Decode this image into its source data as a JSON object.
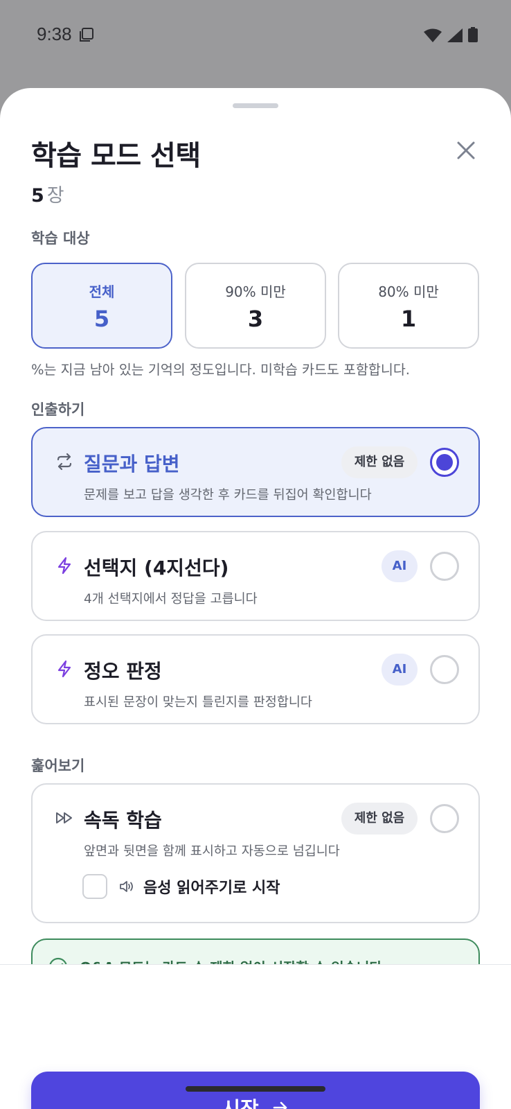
{
  "status_bar": {
    "time": "9:38",
    "left_icon": "screenshot-notification-icon",
    "right_icons": [
      "wifi-icon",
      "cell-signal-icon",
      "battery-icon"
    ]
  },
  "sheet": {
    "title": "학습 모드 선택",
    "close_icon": "close-icon",
    "count_value": "5",
    "count_unit": "장"
  },
  "target_section": {
    "label": "학습 대상",
    "options": [
      {
        "label": "전체",
        "value": "5",
        "selected": true
      },
      {
        "label": "90% 미만",
        "value": "3",
        "selected": false
      },
      {
        "label": "80% 미만",
        "value": "1",
        "selected": false
      }
    ],
    "hint": "%는 지금 남아 있는 기억의 정도입니다. 미학습 카드도 포함합니다."
  },
  "recall_section": {
    "label": "인출하기",
    "modes": [
      {
        "icon": "repeat-icon",
        "title": "질문과 답변",
        "description": "문제를 보고 답을 생각한 후 카드를 뒤집어 확인합니다",
        "badge": "제한 없음",
        "selected": true
      },
      {
        "icon": "lightning-icon",
        "title": "선택지 (4지선다)",
        "description": "4개 선택지에서 정답을 고릅니다",
        "badge": "AI",
        "selected": false
      },
      {
        "icon": "lightning-icon",
        "title": "정오 판정",
        "description": "표시된 문장이 맞는지 틀린지를 판정합니다",
        "badge": "AI",
        "selected": false
      }
    ]
  },
  "skim_section": {
    "label": "훑어보기",
    "mode": {
      "icon": "fast-forward-icon",
      "title": "속독 학습",
      "description": "앞면과 뒷면을 함께 표시하고 자동으로 넘깁니다",
      "badge": "제한 없음",
      "selected": false
    },
    "tts_option": {
      "label": "음성 읽어주기로 시작",
      "checked": false,
      "icon": "speaker-icon"
    }
  },
  "notice": {
    "icon": "check-circle-icon",
    "text": "Q&A 모드는 카드 수 제한 없이 시작할 수 있습니다"
  },
  "footer": {
    "start_label": "시작",
    "start_icon": "arrow-right-icon"
  },
  "colors": {
    "accent": "#4c62c9",
    "primary_button": "#4f45de",
    "selected_bg": "#edf1fc",
    "notice_border": "#3d8b5c"
  }
}
